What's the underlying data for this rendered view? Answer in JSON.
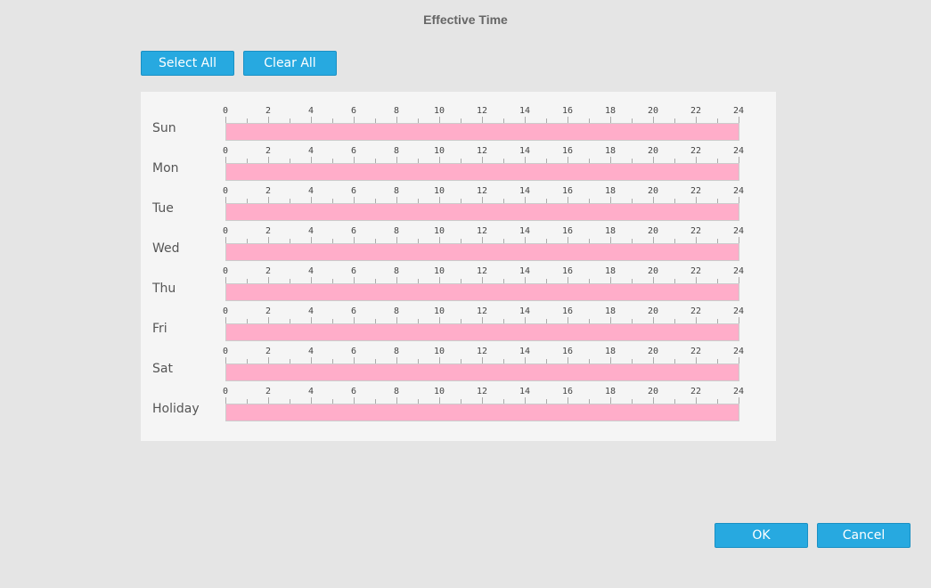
{
  "dialog": {
    "title": "Effective Time"
  },
  "toolbar": {
    "select_all_label": "Select All",
    "clear_all_label": "Clear All"
  },
  "schedule": {
    "hour_labels": [
      "0",
      "2",
      "4",
      "6",
      "8",
      "10",
      "12",
      "14",
      "16",
      "18",
      "20",
      "22",
      "24"
    ],
    "active_color": "#ffadc9",
    "days": [
      {
        "label": "Sun",
        "segments": [
          [
            0,
            24
          ]
        ]
      },
      {
        "label": "Mon",
        "segments": [
          [
            0,
            24
          ]
        ]
      },
      {
        "label": "Tue",
        "segments": [
          [
            0,
            24
          ]
        ]
      },
      {
        "label": "Wed",
        "segments": [
          [
            0,
            24
          ]
        ]
      },
      {
        "label": "Thu",
        "segments": [
          [
            0,
            24
          ]
        ]
      },
      {
        "label": "Fri",
        "segments": [
          [
            0,
            24
          ]
        ]
      },
      {
        "label": "Sat",
        "segments": [
          [
            0,
            24
          ]
        ]
      },
      {
        "label": "Holiday",
        "segments": [
          [
            0,
            24
          ]
        ]
      }
    ]
  },
  "footer": {
    "ok_label": "OK",
    "cancel_label": "Cancel"
  }
}
